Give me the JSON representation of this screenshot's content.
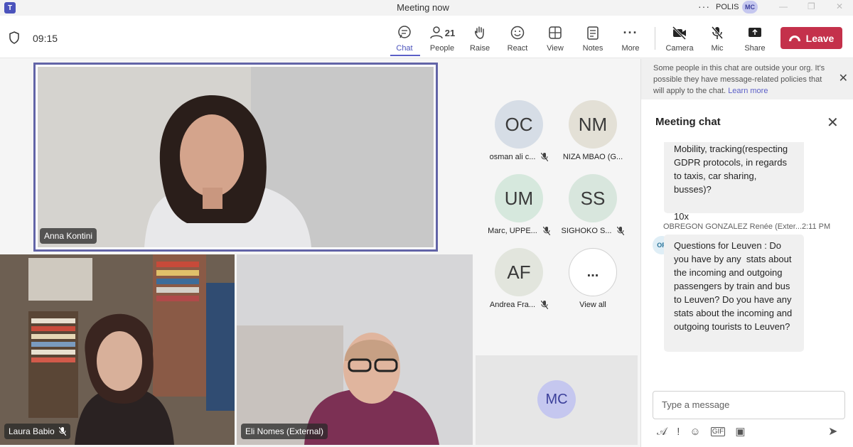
{
  "window": {
    "title": "Meeting now",
    "org": "POLIS",
    "user_initials": "MC"
  },
  "toolbar": {
    "timer": "09:15",
    "buttons": [
      {
        "label": "Chat",
        "icon": "chat-icon"
      },
      {
        "label": "People",
        "icon": "people-icon",
        "count": "21"
      },
      {
        "label": "Raise",
        "icon": "raise-hand-icon"
      },
      {
        "label": "React",
        "icon": "react-icon"
      },
      {
        "label": "View",
        "icon": "view-icon"
      },
      {
        "label": "Notes",
        "icon": "notes-icon"
      },
      {
        "label": "More",
        "icon": "more-icon"
      },
      {
        "label": "Camera",
        "icon": "camera-off-icon"
      },
      {
        "label": "Mic",
        "icon": "mic-off-icon"
      },
      {
        "label": "Share",
        "icon": "share-icon"
      }
    ],
    "leave_label": "Leave"
  },
  "videos": {
    "featured": "Anna Kontini",
    "bottom_left": "Laura Babio",
    "bottom_right": "Eli Nomes (External)",
    "self_initials": "MC"
  },
  "participants": [
    {
      "initials": "OC",
      "name": "osman ali c...",
      "color": "#d6dde6",
      "muted": true
    },
    {
      "initials": "NM",
      "name": "NIZA MBAO (G...",
      "color": "#e3e0d6",
      "muted": false
    },
    {
      "initials": "UM",
      "name": "Marc, UPPE...",
      "color": "#d6e8dd",
      "muted": true
    },
    {
      "initials": "SS",
      "name": "SIGHOKO S...",
      "color": "#d8e6dd",
      "muted": true
    },
    {
      "initials": "AF",
      "name": "Andrea Fra...",
      "color": "#e2e5dd",
      "muted": true
    },
    {
      "initials": "...",
      "name": "View all",
      "color": "#ffffff",
      "muted": false
    }
  ],
  "chat": {
    "banner": "Some people in this chat are outside your org. It's possible they have message-related policies that will apply to the chat.",
    "learn_more": "Learn more",
    "title": "Meeting chat",
    "messages": [
      {
        "text": "Mobility, tracking(respecting GDPR protocols, in regards to taxis, car sharing, busses)?\n\n10x"
      },
      {
        "sender": "OBREGON GONZALEZ Renée (Exter...",
        "time": "2:11 PM",
        "avatar": "OR",
        "text": "Questions for Leuven : Do you have by any  stats about the incoming and outgoing passengers by train and bus to Leuven? Do you have any  stats about the incoming and outgoing tourists to Leuven?"
      }
    ],
    "compose_placeholder": "Type a message"
  },
  "colors": {
    "accent": "#5b5fc7",
    "leave": "#c4314b"
  }
}
